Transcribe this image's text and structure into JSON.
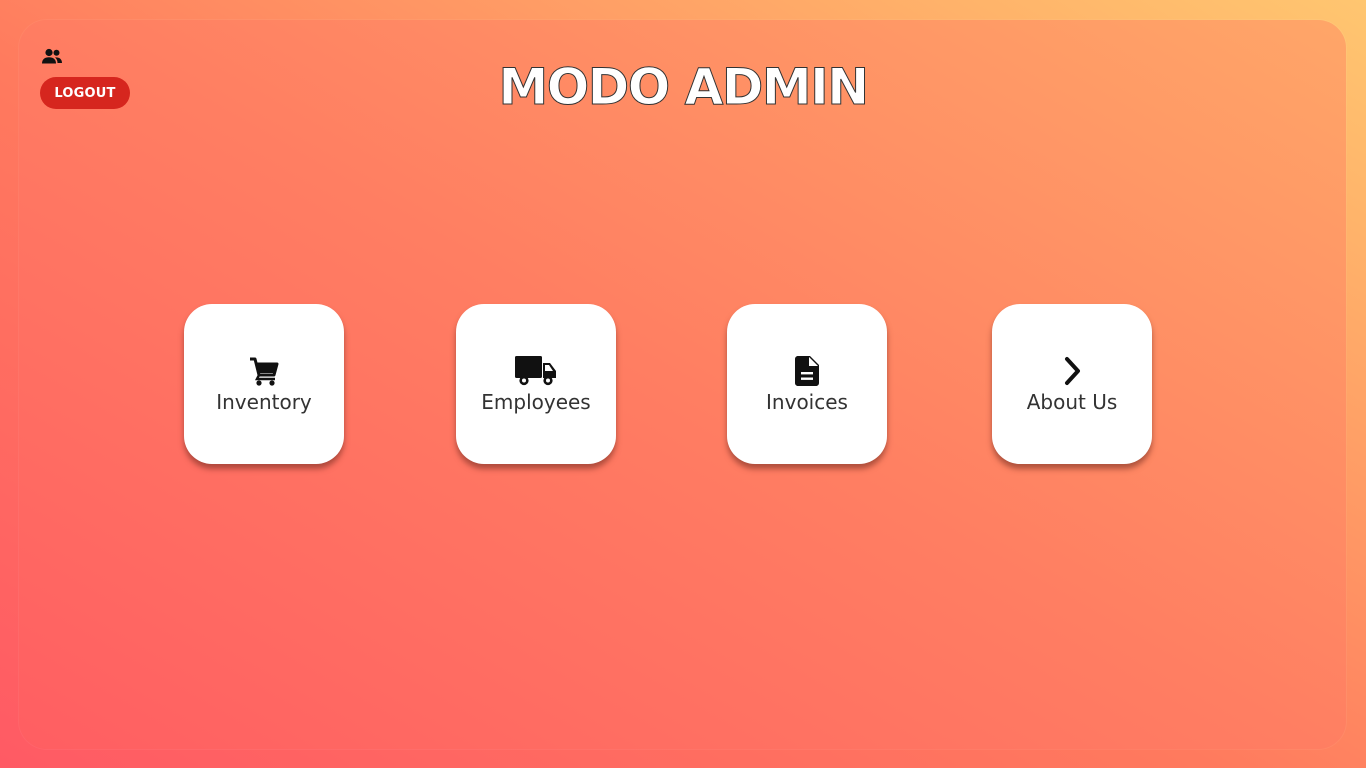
{
  "header": {
    "title": "MODO ADMIN",
    "user_icon": "users-icon",
    "logout_label": "LOGOUT"
  },
  "menu": {
    "items": [
      {
        "label": "Inventory",
        "icon": "cart-icon"
      },
      {
        "label": "Employees",
        "icon": "truck-icon"
      },
      {
        "label": "Invoices",
        "icon": "document-icon"
      },
      {
        "label": "About Us",
        "icon": "chevron-right-icon"
      }
    ]
  },
  "colors": {
    "logout_button": "#d6261e",
    "gradient_start": "#ff5e62",
    "gradient_end": "#ffb36a",
    "tile_background": "#ffffff"
  }
}
